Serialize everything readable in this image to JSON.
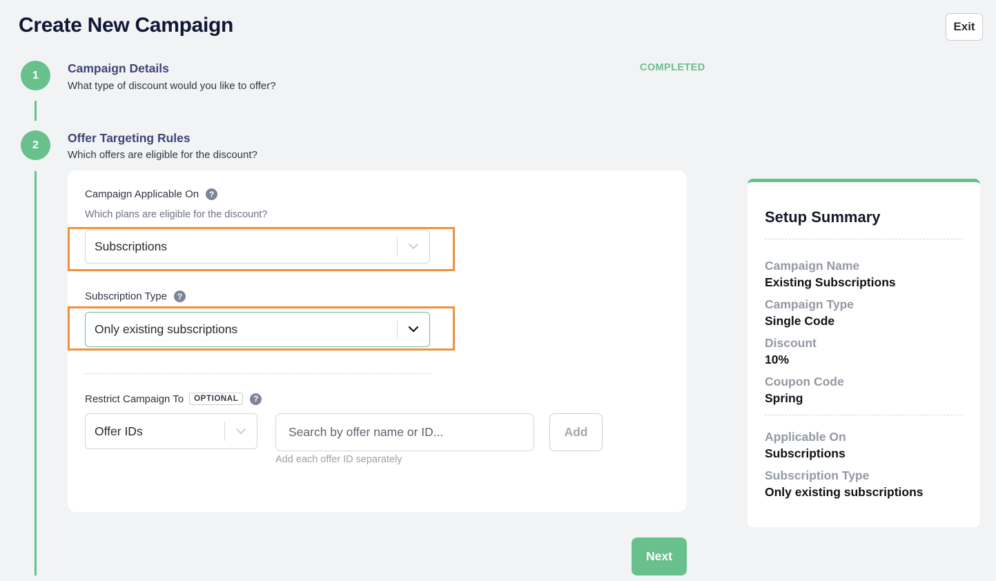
{
  "header": {
    "title": "Create New Campaign",
    "exit_label": "Exit"
  },
  "steps": [
    {
      "number": "1",
      "title": "Campaign Details",
      "subtitle": "What type of discount would you like to offer?",
      "status": "COMPLETED"
    },
    {
      "number": "2",
      "title": "Offer Targeting Rules",
      "subtitle": "Which offers are eligible for the discount?"
    }
  ],
  "form": {
    "applicable_on": {
      "label": "Campaign Applicable On",
      "description": "Which plans are eligible for the discount?",
      "value": "Subscriptions"
    },
    "subscription_type": {
      "label": "Subscription Type",
      "value": "Only existing subscriptions"
    },
    "restrict": {
      "label": "Restrict Campaign To",
      "badge": "OPTIONAL",
      "type_value": "Offer IDs",
      "search_placeholder": "Search by offer name or ID...",
      "add_label": "Add",
      "hint": "Add each offer ID separately"
    },
    "help_glyph": "?"
  },
  "next_label": "Next",
  "summary": {
    "title": "Setup Summary",
    "items": [
      {
        "label": "Campaign Name",
        "value": "Existing Subscriptions"
      },
      {
        "label": "Campaign Type",
        "value": "Single Code"
      },
      {
        "label": "Discount",
        "value": "10%"
      },
      {
        "label": "Coupon Code",
        "value": "Spring"
      },
      {
        "label": "Applicable On",
        "value": "Subscriptions"
      },
      {
        "label": "Subscription Type",
        "value": "Only existing subscriptions"
      }
    ]
  },
  "colors": {
    "accent_green": "#68c08d",
    "highlight_orange": "#f0913a",
    "step_title": "#3d4479"
  }
}
